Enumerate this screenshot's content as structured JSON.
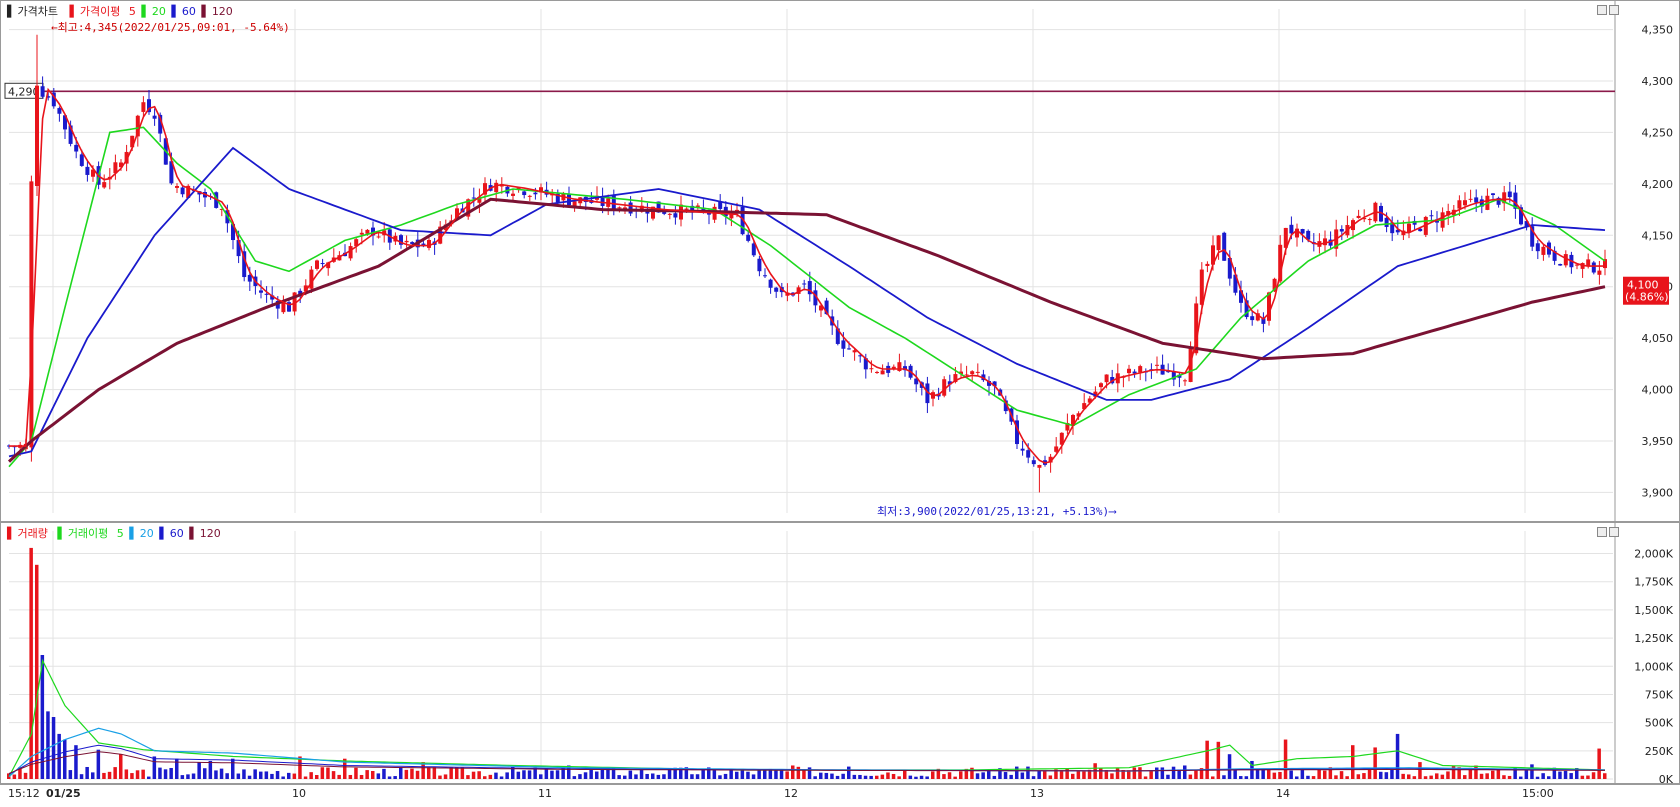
{
  "price_panel": {
    "legend": {
      "title": "가격차트",
      "ma_label": "가격이평",
      "ma_periods": [
        "5",
        "20",
        "60",
        "120"
      ],
      "ma_colors": [
        "#e8141b",
        "#1ed81e",
        "#1a1acc",
        "#7a1233"
      ]
    },
    "high_annotation": "←최고:4,345(2022/01/25,09:01, -5.64%)",
    "low_annotation": "최저:3,900(2022/01/25,13:21, +5.13%)⟶",
    "ref_line_label": "4,290",
    "current_price": "4,100",
    "current_change": "(4.86%)",
    "y_ticks": [
      "4,350",
      "4,300",
      "4,250",
      "4,200",
      "4,150",
      "4,100",
      "4,050",
      "4,000",
      "3,950",
      "3,900"
    ]
  },
  "volume_panel": {
    "legend": {
      "title": "거래량",
      "ma_label": "거래이평",
      "ma_periods": [
        "5",
        "20",
        "60",
        "120"
      ]
    },
    "y_ticks": [
      "2,000K",
      "1,750K",
      "1,500K",
      "1,250K",
      "1,000K",
      "750K",
      "500K",
      "250K",
      "0K"
    ]
  },
  "x_axis": {
    "labels": [
      "15:12",
      "01/25",
      "10",
      "11",
      "12",
      "13",
      "14",
      "15:00"
    ]
  },
  "colors": {
    "up": "#e8141b",
    "down": "#1a1acc",
    "ref_line": "#8b1a4a"
  },
  "chart_data": {
    "type": "candlestick",
    "title": "가격차트",
    "ylim": [
      3880,
      4370
    ],
    "reference_line": 4290,
    "high": 4345,
    "low": 3900,
    "last": 4100,
    "anchor_prices": [
      [
        0,
        3945
      ],
      [
        3,
        3945
      ],
      [
        4,
        4200
      ],
      [
        5,
        4300
      ],
      [
        6,
        4290
      ],
      [
        8,
        4280
      ],
      [
        12,
        4230
      ],
      [
        16,
        4200
      ],
      [
        20,
        4220
      ],
      [
        24,
        4280
      ],
      [
        26,
        4270
      ],
      [
        29,
        4200
      ],
      [
        34,
        4190
      ],
      [
        38,
        4180
      ],
      [
        42,
        4110
      ],
      [
        46,
        4090
      ],
      [
        50,
        4080
      ],
      [
        55,
        4120
      ],
      [
        60,
        4135
      ],
      [
        65,
        4155
      ],
      [
        70,
        4140
      ],
      [
        75,
        4140
      ],
      [
        80,
        4175
      ],
      [
        86,
        4200
      ],
      [
        92,
        4195
      ],
      [
        100,
        4185
      ],
      [
        108,
        4180
      ],
      [
        116,
        4175
      ],
      [
        124,
        4172
      ],
      [
        130,
        4170
      ],
      [
        134,
        4120
      ],
      [
        138,
        4090
      ],
      [
        142,
        4100
      ],
      [
        148,
        4050
      ],
      [
        154,
        4020
      ],
      [
        160,
        4020
      ],
      [
        164,
        3990
      ],
      [
        168,
        4010
      ],
      [
        172,
        4015
      ],
      [
        176,
        4000
      ],
      [
        180,
        3950
      ],
      [
        184,
        3925
      ],
      [
        186,
        3935
      ],
      [
        190,
        3975
      ],
      [
        196,
        4010
      ],
      [
        204,
        4020
      ],
      [
        210,
        4015
      ],
      [
        213,
        4110
      ],
      [
        216,
        4145
      ],
      [
        220,
        4080
      ],
      [
        224,
        4065
      ],
      [
        228,
        4160
      ],
      [
        232,
        4140
      ],
      [
        236,
        4145
      ],
      [
        240,
        4165
      ],
      [
        244,
        4175
      ],
      [
        248,
        4150
      ],
      [
        252,
        4160
      ],
      [
        256,
        4170
      ],
      [
        260,
        4180
      ],
      [
        264,
        4185
      ],
      [
        268,
        4185
      ],
      [
        272,
        4145
      ],
      [
        276,
        4130
      ],
      [
        280,
        4120
      ],
      [
        283,
        4120
      ],
      [
        285,
        4120
      ]
    ],
    "moving_averages": [
      {
        "name": "20",
        "anchors": [
          [
            0,
            3925
          ],
          [
            4,
            3950
          ],
          [
            10,
            4080
          ],
          [
            18,
            4250
          ],
          [
            24,
            4255
          ],
          [
            30,
            4220
          ],
          [
            36,
            4195
          ],
          [
            44,
            4125
          ],
          [
            50,
            4115
          ],
          [
            60,
            4145
          ],
          [
            70,
            4160
          ],
          [
            80,
            4180
          ],
          [
            90,
            4195
          ],
          [
            110,
            4185
          ],
          [
            126,
            4175
          ],
          [
            136,
            4140
          ],
          [
            150,
            4080
          ],
          [
            160,
            4050
          ],
          [
            170,
            4015
          ],
          [
            180,
            3980
          ],
          [
            190,
            3965
          ],
          [
            200,
            3995
          ],
          [
            212,
            4020
          ],
          [
            220,
            4070
          ],
          [
            232,
            4125
          ],
          [
            244,
            4160
          ],
          [
            256,
            4165
          ],
          [
            266,
            4185
          ],
          [
            276,
            4160
          ],
          [
            285,
            4125
          ]
        ]
      },
      {
        "name": "60",
        "anchors": [
          [
            0,
            3935
          ],
          [
            4,
            3940
          ],
          [
            14,
            4050
          ],
          [
            26,
            4150
          ],
          [
            40,
            4235
          ],
          [
            50,
            4195
          ],
          [
            70,
            4155
          ],
          [
            86,
            4150
          ],
          [
            96,
            4180
          ],
          [
            116,
            4195
          ],
          [
            134,
            4175
          ],
          [
            150,
            4120
          ],
          [
            164,
            4070
          ],
          [
            180,
            4025
          ],
          [
            196,
            3990
          ],
          [
            204,
            3990
          ],
          [
            218,
            4010
          ],
          [
            232,
            4060
          ],
          [
            248,
            4120
          ],
          [
            260,
            4140
          ],
          [
            272,
            4160
          ],
          [
            285,
            4155
          ]
        ]
      },
      {
        "name": "120",
        "anchors": [
          [
            0,
            3930
          ],
          [
            4,
            3950
          ],
          [
            16,
            4000
          ],
          [
            30,
            4045
          ],
          [
            46,
            4080
          ],
          [
            66,
            4120
          ],
          [
            86,
            4185
          ],
          [
            106,
            4175
          ],
          [
            126,
            4173
          ],
          [
            146,
            4170
          ],
          [
            166,
            4130
          ],
          [
            186,
            4085
          ],
          [
            206,
            4045
          ],
          [
            224,
            4030
          ],
          [
            240,
            4035
          ],
          [
            256,
            4060
          ],
          [
            272,
            4085
          ],
          [
            285,
            4100
          ]
        ]
      }
    ],
    "volume": {
      "ylim": [
        0,
        2200
      ],
      "unit": "K",
      "spikes": [
        [
          4,
          2050
        ],
        [
          5,
          1900
        ],
        [
          6,
          1100
        ],
        [
          7,
          600
        ],
        [
          8,
          550
        ],
        [
          9,
          400
        ],
        [
          10,
          350
        ],
        [
          12,
          300
        ],
        [
          16,
          260
        ],
        [
          20,
          220
        ],
        [
          26,
          200
        ],
        [
          30,
          180
        ],
        [
          34,
          150
        ],
        [
          36,
          160
        ],
        [
          40,
          180
        ],
        [
          52,
          200
        ],
        [
          60,
          180
        ],
        [
          74,
          150
        ],
        [
          100,
          120
        ],
        [
          120,
          100
        ],
        [
          140,
          120
        ],
        [
          150,
          110
        ],
        [
          166,
          90
        ],
        [
          180,
          110
        ],
        [
          194,
          140
        ],
        [
          210,
          120
        ],
        [
          214,
          340
        ],
        [
          216,
          330
        ],
        [
          218,
          220
        ],
        [
          222,
          160
        ],
        [
          228,
          350
        ],
        [
          240,
          300
        ],
        [
          244,
          280
        ],
        [
          248,
          400
        ],
        [
          252,
          150
        ],
        [
          258,
          120
        ],
        [
          262,
          120
        ],
        [
          272,
          130
        ],
        [
          276,
          100
        ],
        [
          284,
          270
        ]
      ],
      "ma5_anchors": [
        [
          0,
          20
        ],
        [
          4,
          400
        ],
        [
          6,
          1050
        ],
        [
          10,
          650
        ],
        [
          16,
          320
        ],
        [
          24,
          260
        ],
        [
          40,
          200
        ],
        [
          60,
          160
        ],
        [
          90,
          120
        ],
        [
          130,
          80
        ],
        [
          170,
          80
        ],
        [
          200,
          100
        ],
        [
          214,
          250
        ],
        [
          218,
          300
        ],
        [
          222,
          120
        ],
        [
          230,
          180
        ],
        [
          240,
          200
        ],
        [
          248,
          250
        ],
        [
          256,
          120
        ],
        [
          285,
          80
        ]
      ],
      "ma20_anchors": [
        [
          0,
          20
        ],
        [
          4,
          200
        ],
        [
          10,
          350
        ],
        [
          16,
          450
        ],
        [
          20,
          400
        ],
        [
          26,
          250
        ],
        [
          40,
          230
        ],
        [
          60,
          150
        ],
        [
          100,
          100
        ],
        [
          150,
          80
        ],
        [
          200,
          70
        ],
        [
          220,
          90
        ],
        [
          250,
          100
        ],
        [
          285,
          80
        ]
      ]
    }
  }
}
